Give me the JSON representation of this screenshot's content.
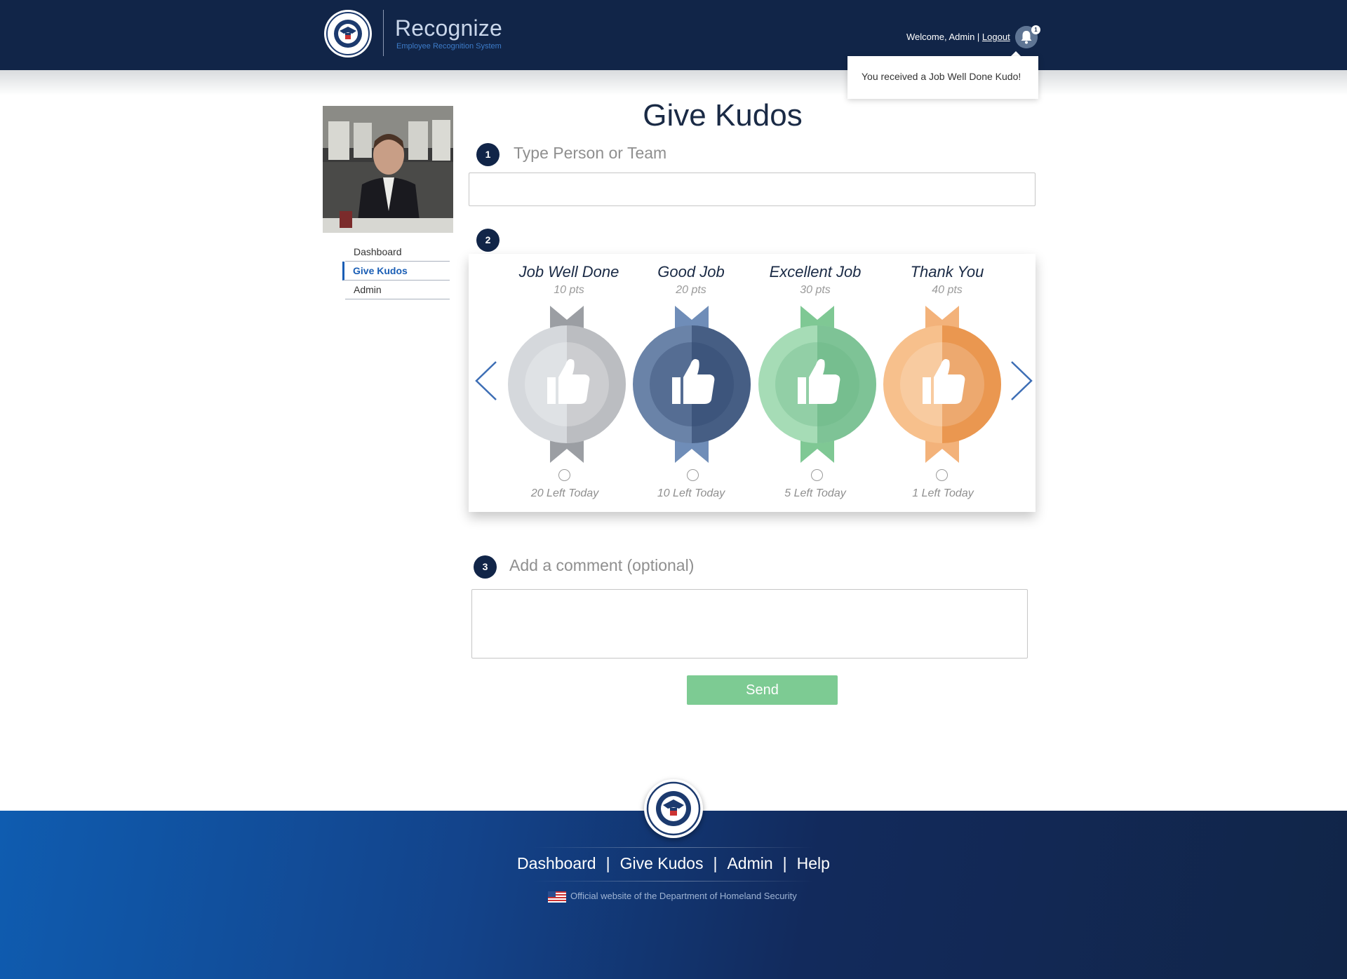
{
  "header": {
    "app_title": "Recognize",
    "app_subtitle": "Employee Recognition System",
    "welcome_text": "Welcome, Admin |",
    "logout_label": "Logout",
    "notification_count": "1",
    "toast_text": "You received a Job Well Done Kudo!"
  },
  "sidebar": {
    "items": [
      {
        "label": "Dashboard"
      },
      {
        "label": "Give Kudos"
      },
      {
        "label": "Admin"
      }
    ]
  },
  "main": {
    "title": "Give Kudos",
    "step1": {
      "number": "1",
      "label": "Type Person or Team",
      "value": ""
    },
    "step2": {
      "number": "2"
    },
    "kudos": [
      {
        "name": "Job Well Done",
        "points": "10 pts",
        "left": "20 Left Today",
        "color_light": "#d5d8dc",
        "color_dark": "#a5a8ac",
        "ribbon": "#9b9ea3"
      },
      {
        "name": "Good Job",
        "points": "20 pts",
        "left": "10 Left Today",
        "color_light": "#6a83a8",
        "color_dark": "#2f466c",
        "ribbon": "#6f8db8"
      },
      {
        "name": "Excellent Job",
        "points": "30 pts",
        "left": "5 Left Today",
        "color_light": "#a6dcb6",
        "color_dark": "#64b380",
        "ribbon": "#7fc894"
      },
      {
        "name": "Thank You",
        "points": "40 pts",
        "left": "1 Left Today",
        "color_light": "#f7c08c",
        "color_dark": "#e5893c",
        "ribbon": "#f3b27a"
      }
    ],
    "step3": {
      "number": "3",
      "label": "Add a comment (optional)",
      "value": ""
    },
    "send_label": "Send"
  },
  "footer": {
    "links": [
      "Dashboard",
      "Give Kudos",
      "Admin",
      "Help"
    ],
    "separator": "|",
    "official_text": "Official website of the Department of Homeland Security"
  },
  "colors": {
    "header_bg": "#112548",
    "accent_blue": "#1a5eb5",
    "send_green": "#7dcb93"
  },
  "icons": [
    "dhs-seal-icon",
    "bell-icon",
    "chevron-left-icon",
    "chevron-right-icon",
    "thumbs-up-icon",
    "us-flag-icon"
  ]
}
